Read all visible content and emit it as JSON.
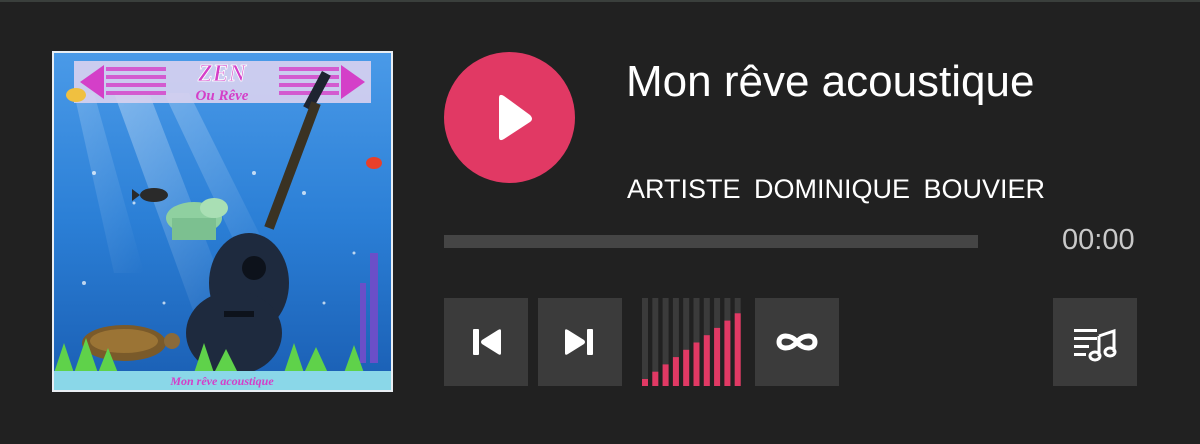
{
  "player": {
    "track_title": "Mon rêve acoustique",
    "artist_line": "ARTISTE  DOMINIQUE  BOUVIER",
    "time": "00:00",
    "progress": 0,
    "volume_level": 1.0,
    "volume_bars": 11
  },
  "cover": {
    "banner_title": "ZEN",
    "banner_subtitle": "Ou Rêve",
    "caption": "Mon rêve acoustique"
  },
  "icons": {
    "play": "play-icon",
    "previous": "skip-previous-icon",
    "next": "skip-next-icon",
    "repeat": "repeat-infinity-icon",
    "playlist": "playlist-music-icon"
  },
  "colors": {
    "accent": "#e13964",
    "background": "#212121",
    "button": "#3b3b3b",
    "track": "#454545",
    "time_text": "#c9c9c9"
  }
}
